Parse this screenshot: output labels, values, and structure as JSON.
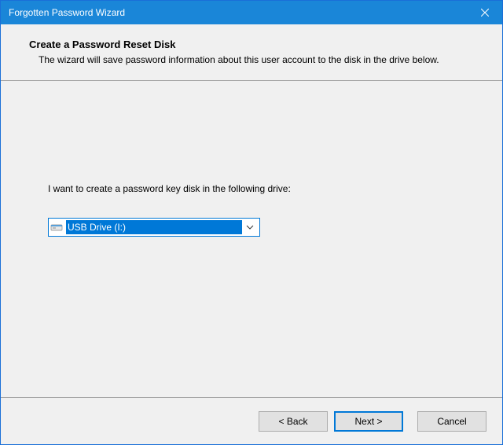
{
  "titlebar": {
    "title": "Forgotten Password Wizard"
  },
  "header": {
    "title": "Create a Password Reset Disk",
    "description": "The wizard will save password information about this user account to the disk in the drive below."
  },
  "body": {
    "prompt": "I want to create a password key disk in the following drive:",
    "drive_select": {
      "selected": "USB Drive (I:)"
    }
  },
  "buttons": {
    "back": "< Back",
    "next": "Next >",
    "cancel": "Cancel"
  }
}
